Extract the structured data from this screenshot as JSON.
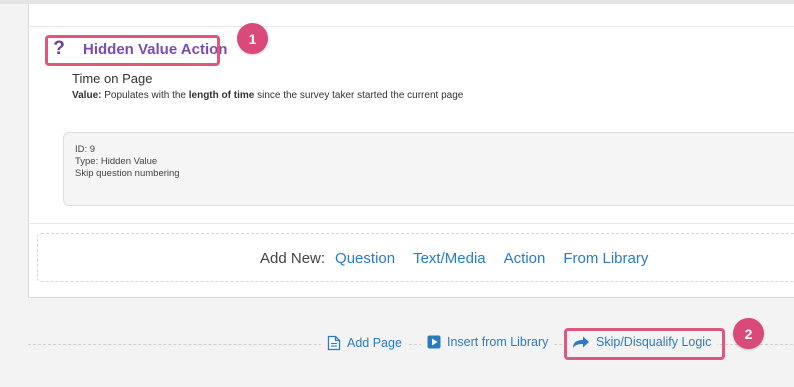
{
  "question": {
    "icon": "question-mark-icon",
    "title": "Hidden Value Action",
    "subtitle": "Time on Page",
    "value_prefix": "Value:",
    "value_text_1": "Populates with the",
    "value_bold": "length of time",
    "value_text_2": "since the survey taker started the current page"
  },
  "details": {
    "id_line": "ID: 9",
    "type_line": "Type: Hidden Value",
    "skip_line": "Skip question numbering"
  },
  "add_new": {
    "label": "Add New:",
    "links": [
      "Question",
      "Text/Media",
      "Action",
      "From Library"
    ]
  },
  "footer": {
    "add_page": "Add Page",
    "insert_from_library": "Insert from Library",
    "skip_logic": "Skip/Disqualify Logic"
  },
  "callouts": {
    "one": "1",
    "two": "2"
  },
  "colors": {
    "accent_purple": "#7b4bb3",
    "link_blue": "#2b7bc1",
    "highlight_pink": "#e0577e"
  }
}
